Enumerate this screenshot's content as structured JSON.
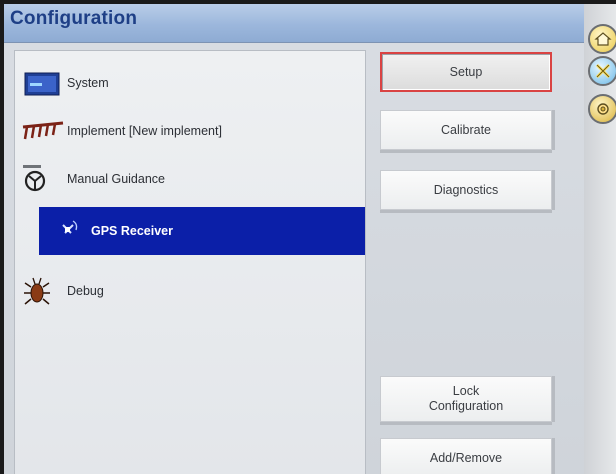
{
  "header": {
    "title": "Configuration"
  },
  "dock": [
    {
      "name": "home-icon"
    },
    {
      "name": "tools-icon"
    },
    {
      "name": "config-icon"
    }
  ],
  "list": [
    {
      "label": "System",
      "icon": "system-icon",
      "selected": false
    },
    {
      "label": "Implement [New implement]",
      "icon": "implement-icon",
      "selected": false
    },
    {
      "label": "Manual Guidance",
      "icon": "steering-wheel-icon",
      "selected": false
    },
    {
      "label": "GPS Receiver",
      "icon": "satellite-icon",
      "selected": true
    },
    {
      "label": "Debug",
      "icon": "bug-icon",
      "selected": false
    }
  ],
  "buttons": {
    "setup": "Setup",
    "calibrate": "Calibrate",
    "diagnostics": "Diagnostics",
    "lock": "Lock Configuration",
    "add_remove": "Add/Remove"
  },
  "colors": {
    "title": "#1e3f86",
    "selection": "#0b1fa8",
    "setup_border": "#d94343"
  }
}
